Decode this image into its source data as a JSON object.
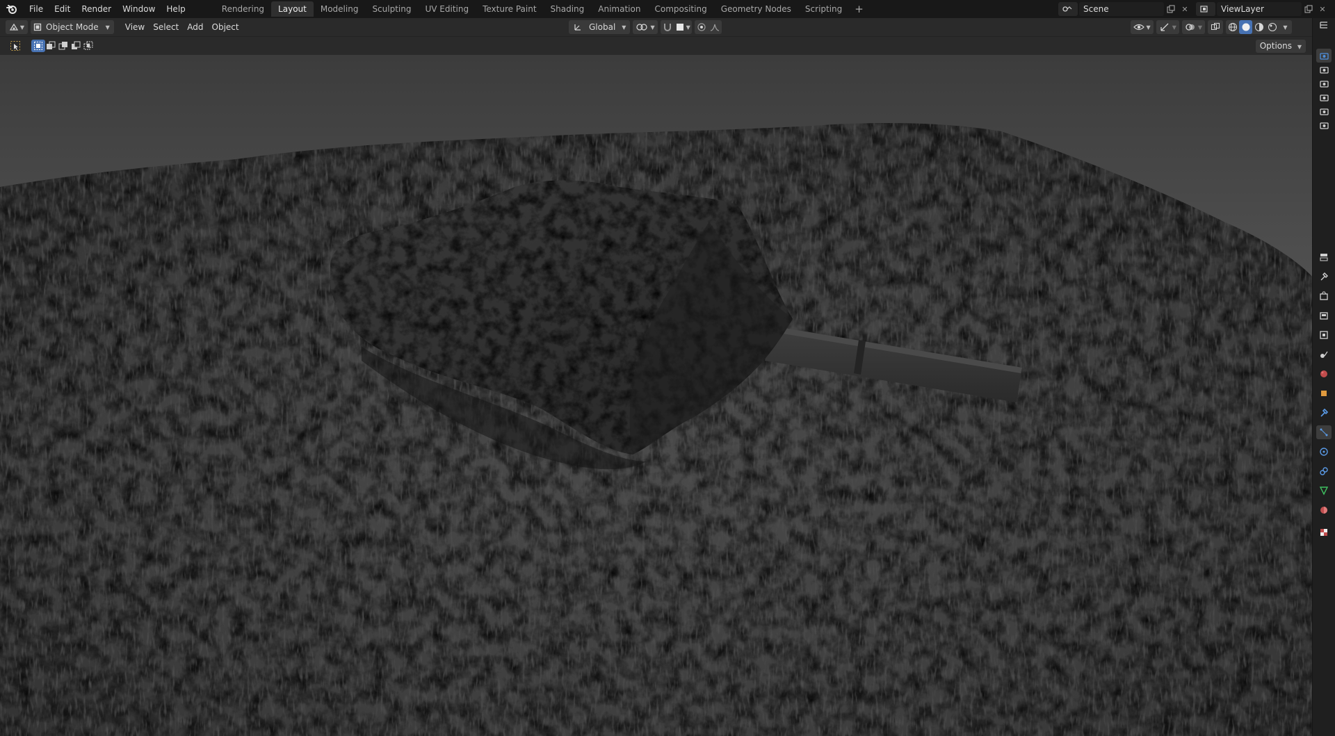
{
  "topbar": {
    "menus": [
      "File",
      "Edit",
      "Render",
      "Window",
      "Help"
    ],
    "workspaces": [
      "Rendering",
      "Layout",
      "Modeling",
      "Sculpting",
      "UV Editing",
      "Texture Paint",
      "Shading",
      "Animation",
      "Compositing",
      "Geometry Nodes",
      "Scripting"
    ],
    "active_workspace": "Layout",
    "add_workspace": "+",
    "scene_name": "Scene",
    "view_layer_name": "ViewLayer"
  },
  "header": {
    "mode": "Object Mode",
    "menus": [
      "View",
      "Select",
      "Add",
      "Object"
    ],
    "transform_orientation": "Global"
  },
  "toolsettings": {
    "options_label": "Options"
  },
  "colors": {
    "accent": "#4772b3",
    "topbar_bg": "#181818",
    "header_bg": "#2a2a2a",
    "strip_bg": "#1f1f1f"
  },
  "icons": {
    "properties_tabs": [
      "tool-icon",
      "render-icon",
      "output-icon",
      "view-layer-icon",
      "scene-icon",
      "world-icon",
      "object-icon",
      "modifier-icon",
      "particles-icon",
      "physics-icon",
      "constraints-icon",
      "data-icon",
      "material-icon",
      "texture-icon"
    ]
  }
}
